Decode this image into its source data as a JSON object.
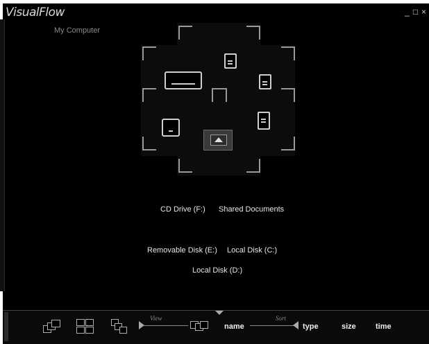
{
  "app": {
    "title": "VisualFlow",
    "minimize": "_",
    "maximize": "□",
    "close": "×"
  },
  "breadcrumb": "My Computer",
  "items": [
    {
      "label": "CD Drive (F:)",
      "icon": "cd-drive-icon"
    },
    {
      "label": "Shared Documents",
      "icon": "folder-icon"
    },
    {
      "label": "Removable Disk (E:)",
      "icon": "removable-disk-icon"
    },
    {
      "label": "Local Disk (C:)",
      "icon": "hard-disk-icon"
    },
    {
      "label": "Local Disk (D:)",
      "icon": "hard-disk-icon"
    }
  ],
  "toolbar": {
    "view_label": "View",
    "sort_label": "Sort",
    "view_modes": [
      "cascade-view-icon",
      "grid-view-icon",
      "tree-view-icon",
      "stack-view-icon"
    ],
    "sort_options": [
      "name",
      "type",
      "size",
      "time"
    ],
    "active_sort": "name"
  },
  "colors": {
    "background": "#000000",
    "text": "#e6e6e6",
    "muted": "#8a8a8a"
  }
}
